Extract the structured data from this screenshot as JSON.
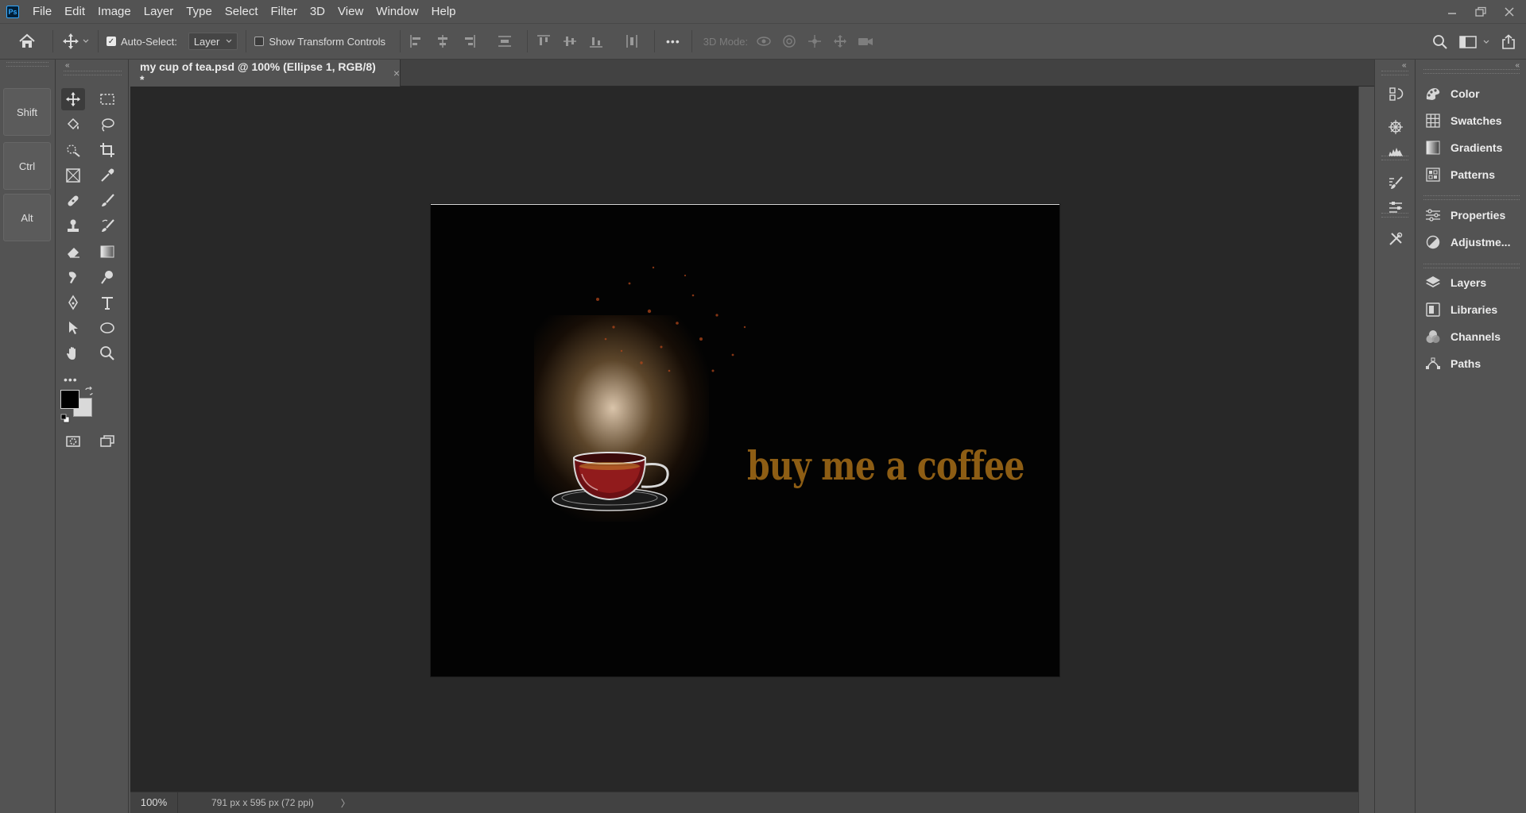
{
  "app": {
    "logo_text": "Ps"
  },
  "menu": [
    "File",
    "Edit",
    "Image",
    "Layer",
    "Type",
    "Select",
    "Filter",
    "3D",
    "View",
    "Window",
    "Help"
  ],
  "options_bar": {
    "auto_select_label": "Auto-Select:",
    "auto_select_checked": true,
    "auto_select_value": "Layer",
    "show_transform_label": "Show Transform Controls",
    "show_transform_checked": false,
    "more_label": "•••",
    "mode_3d_label": "3D Mode:"
  },
  "modifier_keys": [
    "Shift",
    "Ctrl",
    "Alt"
  ],
  "toolbox": {
    "more_tools_label": "•••",
    "foreground_color": "#000000",
    "background_color": "#d9d9d9"
  },
  "document": {
    "tab_title": "my cup of tea.psd @ 100% (Ellipse 1, RGB/8) *",
    "close_glyph": "×",
    "artwork_text": "buy me a coffee",
    "artwork_text_color": "#8d5d14",
    "background_color": "#030303"
  },
  "status_bar": {
    "zoom": "100%",
    "doc_info": "791 px x 595 px (72 ppi)",
    "arrow": "〉"
  },
  "right_panels": [
    {
      "label": "Color",
      "icon": "color-icon"
    },
    {
      "label": "Swatches",
      "icon": "swatches-icon"
    },
    {
      "label": "Gradients",
      "icon": "gradients-icon"
    },
    {
      "label": "Patterns",
      "icon": "patterns-icon"
    },
    {
      "label": "Properties",
      "icon": "properties-icon"
    },
    {
      "label": "Adjustme...",
      "icon": "adjustments-icon"
    },
    {
      "label": "Layers",
      "icon": "layers-icon"
    },
    {
      "label": "Libraries",
      "icon": "libraries-icon"
    },
    {
      "label": "Channels",
      "icon": "channels-icon"
    },
    {
      "label": "Paths",
      "icon": "paths-icon"
    }
  ],
  "colors": {
    "ui_panel": "#535353",
    "canvas_bg": "#282828",
    "accent": "#31a8ff"
  }
}
